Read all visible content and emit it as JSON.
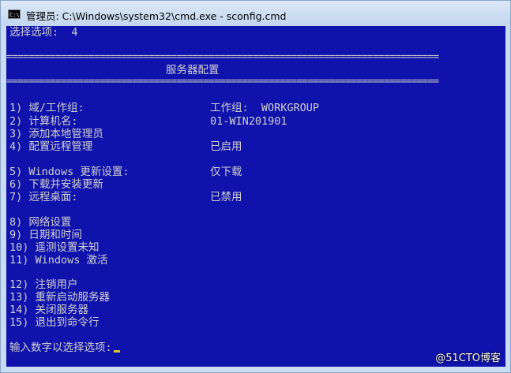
{
  "window": {
    "title": "管理员: C:\\Windows\\system32\\cmd.exe - sconfig.cmd",
    "icon": "cmd-icon",
    "icon_text": "C:\\."
  },
  "console": {
    "prompt_top": "选择选项:  4",
    "separator": "===============================================================================",
    "heading": "服务器配置",
    "menu": [
      {
        "label": "1) 域/工作组:",
        "value": "工作组:  WORKGROUP"
      },
      {
        "label": "2) 计算机名:",
        "value": "01-WIN201901"
      },
      {
        "label": "3) 添加本地管理员",
        "value": ""
      },
      {
        "label": "4) 配置远程管理",
        "value": "已启用"
      },
      {
        "label": "5) Windows 更新设置:",
        "value": "仅下载"
      },
      {
        "label": "6) 下载并安装更新",
        "value": ""
      },
      {
        "label": "7) 远程桌面:",
        "value": "已禁用"
      },
      {
        "label": "8) 网络设置",
        "value": ""
      },
      {
        "label": "9) 日期和时间",
        "value": ""
      },
      {
        "label": "10) 遥测设置未知",
        "value": ""
      },
      {
        "label": "11) Windows 激活",
        "value": ""
      },
      {
        "label": "12) 注销用户",
        "value": ""
      },
      {
        "label": "13) 重新启动服务器",
        "value": ""
      },
      {
        "label": "14) 关闭服务器",
        "value": ""
      },
      {
        "label": "15) 退出到命令行",
        "value": ""
      }
    ],
    "input_prompt": "输入数字以选择选项:"
  },
  "watermark": "@51CTO博客",
  "colors": {
    "console_background": "#0f12ab",
    "console_text": "#d0d0d0",
    "cursor": "#e0c030"
  }
}
